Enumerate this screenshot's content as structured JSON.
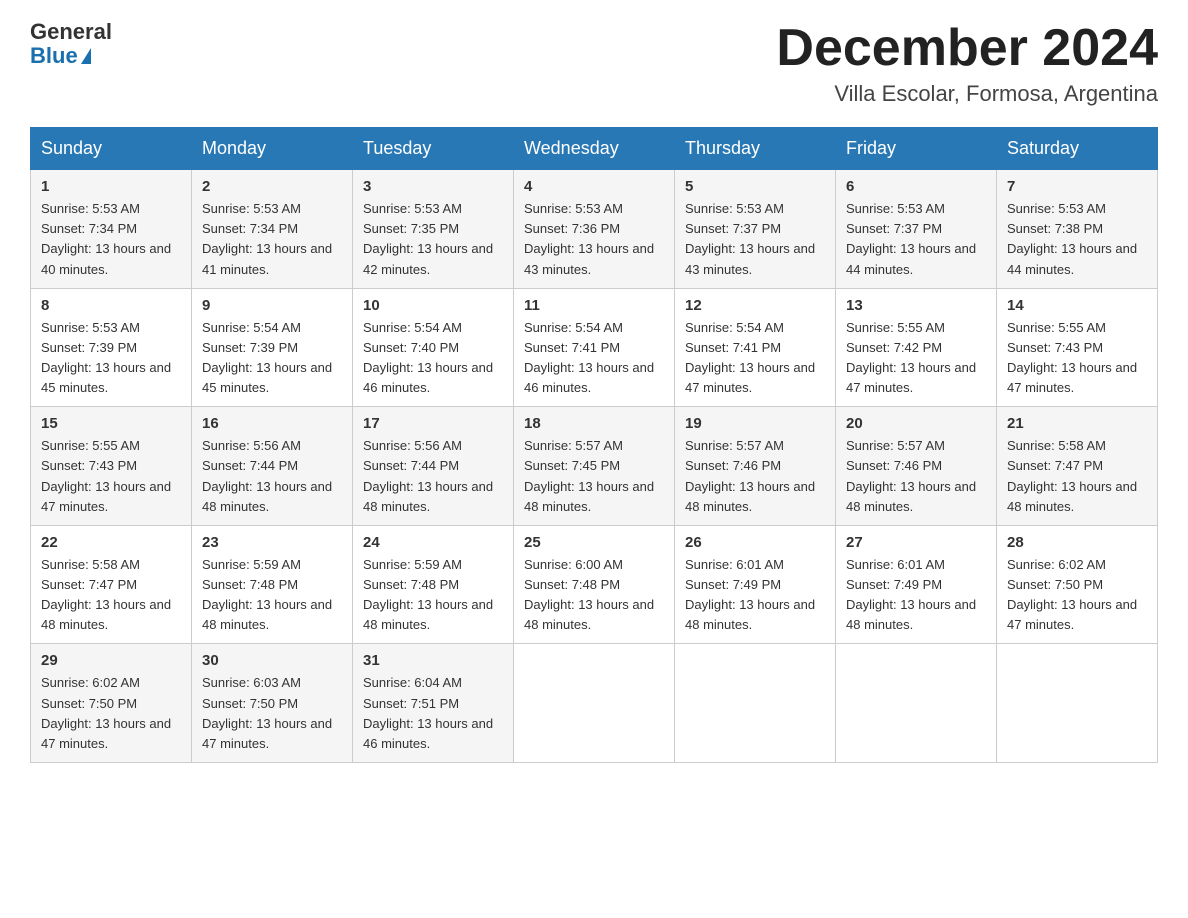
{
  "logo": {
    "line1": "General",
    "line2": "Blue"
  },
  "header": {
    "title": "December 2024",
    "subtitle": "Villa Escolar, Formosa, Argentina"
  },
  "weekdays": [
    "Sunday",
    "Monday",
    "Tuesday",
    "Wednesday",
    "Thursday",
    "Friday",
    "Saturday"
  ],
  "weeks": [
    [
      {
        "day": "1",
        "sunrise": "5:53 AM",
        "sunset": "7:34 PM",
        "daylight": "13 hours and 40 minutes."
      },
      {
        "day": "2",
        "sunrise": "5:53 AM",
        "sunset": "7:34 PM",
        "daylight": "13 hours and 41 minutes."
      },
      {
        "day": "3",
        "sunrise": "5:53 AM",
        "sunset": "7:35 PM",
        "daylight": "13 hours and 42 minutes."
      },
      {
        "day": "4",
        "sunrise": "5:53 AM",
        "sunset": "7:36 PM",
        "daylight": "13 hours and 43 minutes."
      },
      {
        "day": "5",
        "sunrise": "5:53 AM",
        "sunset": "7:37 PM",
        "daylight": "13 hours and 43 minutes."
      },
      {
        "day": "6",
        "sunrise": "5:53 AM",
        "sunset": "7:37 PM",
        "daylight": "13 hours and 44 minutes."
      },
      {
        "day": "7",
        "sunrise": "5:53 AM",
        "sunset": "7:38 PM",
        "daylight": "13 hours and 44 minutes."
      }
    ],
    [
      {
        "day": "8",
        "sunrise": "5:53 AM",
        "sunset": "7:39 PM",
        "daylight": "13 hours and 45 minutes."
      },
      {
        "day": "9",
        "sunrise": "5:54 AM",
        "sunset": "7:39 PM",
        "daylight": "13 hours and 45 minutes."
      },
      {
        "day": "10",
        "sunrise": "5:54 AM",
        "sunset": "7:40 PM",
        "daylight": "13 hours and 46 minutes."
      },
      {
        "day": "11",
        "sunrise": "5:54 AM",
        "sunset": "7:41 PM",
        "daylight": "13 hours and 46 minutes."
      },
      {
        "day": "12",
        "sunrise": "5:54 AM",
        "sunset": "7:41 PM",
        "daylight": "13 hours and 47 minutes."
      },
      {
        "day": "13",
        "sunrise": "5:55 AM",
        "sunset": "7:42 PM",
        "daylight": "13 hours and 47 minutes."
      },
      {
        "day": "14",
        "sunrise": "5:55 AM",
        "sunset": "7:43 PM",
        "daylight": "13 hours and 47 minutes."
      }
    ],
    [
      {
        "day": "15",
        "sunrise": "5:55 AM",
        "sunset": "7:43 PM",
        "daylight": "13 hours and 47 minutes."
      },
      {
        "day": "16",
        "sunrise": "5:56 AM",
        "sunset": "7:44 PM",
        "daylight": "13 hours and 48 minutes."
      },
      {
        "day": "17",
        "sunrise": "5:56 AM",
        "sunset": "7:44 PM",
        "daylight": "13 hours and 48 minutes."
      },
      {
        "day": "18",
        "sunrise": "5:57 AM",
        "sunset": "7:45 PM",
        "daylight": "13 hours and 48 minutes."
      },
      {
        "day": "19",
        "sunrise": "5:57 AM",
        "sunset": "7:46 PM",
        "daylight": "13 hours and 48 minutes."
      },
      {
        "day": "20",
        "sunrise": "5:57 AM",
        "sunset": "7:46 PM",
        "daylight": "13 hours and 48 minutes."
      },
      {
        "day": "21",
        "sunrise": "5:58 AM",
        "sunset": "7:47 PM",
        "daylight": "13 hours and 48 minutes."
      }
    ],
    [
      {
        "day": "22",
        "sunrise": "5:58 AM",
        "sunset": "7:47 PM",
        "daylight": "13 hours and 48 minutes."
      },
      {
        "day": "23",
        "sunrise": "5:59 AM",
        "sunset": "7:48 PM",
        "daylight": "13 hours and 48 minutes."
      },
      {
        "day": "24",
        "sunrise": "5:59 AM",
        "sunset": "7:48 PM",
        "daylight": "13 hours and 48 minutes."
      },
      {
        "day": "25",
        "sunrise": "6:00 AM",
        "sunset": "7:48 PM",
        "daylight": "13 hours and 48 minutes."
      },
      {
        "day": "26",
        "sunrise": "6:01 AM",
        "sunset": "7:49 PM",
        "daylight": "13 hours and 48 minutes."
      },
      {
        "day": "27",
        "sunrise": "6:01 AM",
        "sunset": "7:49 PM",
        "daylight": "13 hours and 48 minutes."
      },
      {
        "day": "28",
        "sunrise": "6:02 AM",
        "sunset": "7:50 PM",
        "daylight": "13 hours and 47 minutes."
      }
    ],
    [
      {
        "day": "29",
        "sunrise": "6:02 AM",
        "sunset": "7:50 PM",
        "daylight": "13 hours and 47 minutes."
      },
      {
        "day": "30",
        "sunrise": "6:03 AM",
        "sunset": "7:50 PM",
        "daylight": "13 hours and 47 minutes."
      },
      {
        "day": "31",
        "sunrise": "6:04 AM",
        "sunset": "7:51 PM",
        "daylight": "13 hours and 46 minutes."
      },
      null,
      null,
      null,
      null
    ]
  ]
}
